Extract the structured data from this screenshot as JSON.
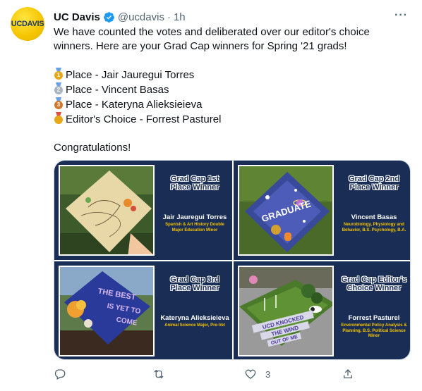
{
  "tweet": {
    "author_name": "UC Davis",
    "handle": "@ucdavis",
    "separator": "·",
    "time": "1h",
    "avatar_text": "UCDAVIS",
    "more_label": "···",
    "text_line1": "We have counted the votes and deliberated over our editor's choice winners. Here are your Grad Cap winners for Spring '21 grads!",
    "list": [
      {
        "medal": "1",
        "text": "Place - Jair Jauregui Torres"
      },
      {
        "medal": "2",
        "text": "Place - Vincent Basas"
      },
      {
        "medal": "3",
        "text": "Place - Kateryna Alieksieieva"
      },
      {
        "medal": "",
        "text": "Editor's Choice - Forrest Pasturel"
      }
    ],
    "closing": "Congratulations!"
  },
  "media": [
    {
      "title": "Grad Cap 1st Place Winner",
      "name": "Jair Jauregui Torres",
      "desc": "Spanish & Art History Double Major Education Minor",
      "photo": "cap-flower-drawing"
    },
    {
      "title": "Grad Cap 2nd Place Winner",
      "name": "Vincent Basas",
      "desc": "Neurobiology, Physiology and Behavior, B.S. Psychology, B.A.",
      "photo": "cap-space-among-us"
    },
    {
      "title": "Grad Cap 3rd Place Winner",
      "name": "Kateryna Alieksieieva",
      "desc": "Animal Science Major, Pre-Vet",
      "photo": "cap-best-is-yet-to-come"
    },
    {
      "title": "Grad Cap Editor's Choice Winner",
      "name": "Forrest Pasturel",
      "desc": "Environmental Policy Analysis & Planning, B.S. Political Science Minor",
      "photo": "cap-wind-turbines"
    }
  ],
  "actions": {
    "reply_icon": "reply-icon",
    "retweet_icon": "retweet-icon",
    "like_icon": "heart-icon",
    "like_count": "3",
    "share_icon": "share-icon"
  },
  "colors": {
    "brand_navy": "#1a2d55",
    "brand_gold": "#f5c400",
    "verified_blue": "#1d9bf0",
    "muted": "#536471"
  }
}
